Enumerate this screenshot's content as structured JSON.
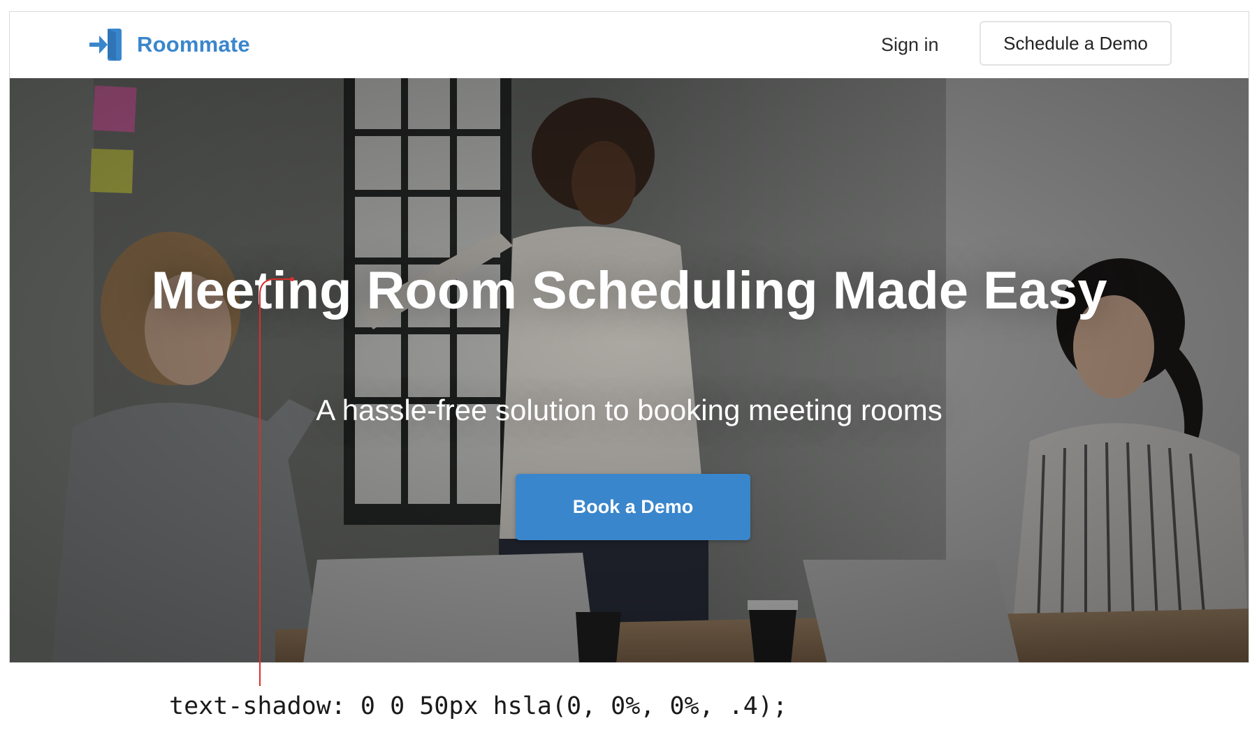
{
  "header": {
    "brand": "Roommate",
    "sign_in": "Sign in",
    "schedule_demo": "Schedule a Demo"
  },
  "hero": {
    "headline": "Meeting Room Scheduling Made Easy",
    "subheadline": "A hassle-free solution to booking meeting rooms",
    "cta": "Book a Demo"
  },
  "annotation": {
    "code": "text-shadow: 0 0 50px hsla(0, 0%, 0%, .4);"
  },
  "colors": {
    "brand_blue": "#3a86cc",
    "annotation_line": "#d9302c"
  },
  "icons": {
    "logo": "door-enter-icon"
  }
}
